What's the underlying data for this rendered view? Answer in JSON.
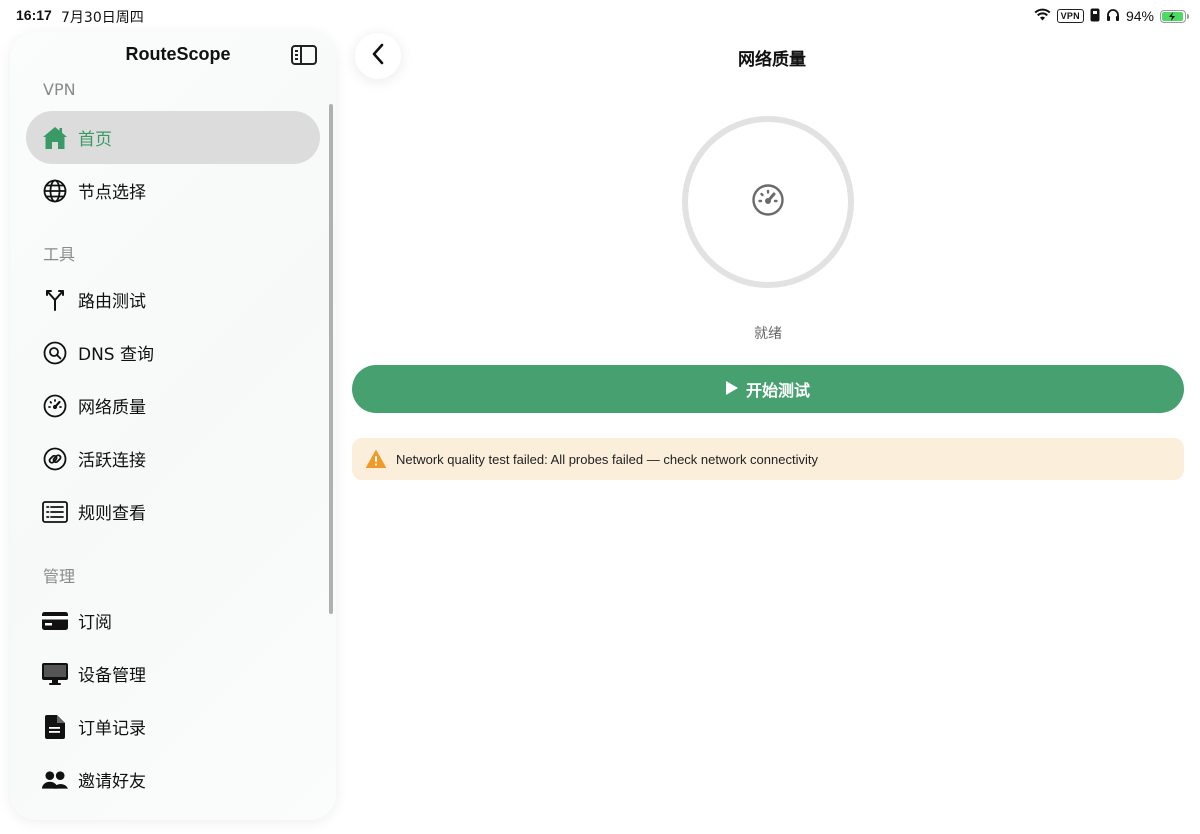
{
  "status_bar": {
    "time": "16:17",
    "date": "7月30日周四",
    "vpn_badge": "VPN",
    "battery": "94%",
    "battery_level_percent": 94,
    "icons": [
      "wifi-icon",
      "vpn-icon",
      "lock-icon",
      "headphones-icon",
      "battery-charging-icon"
    ]
  },
  "sidebar": {
    "title": "RouteScope",
    "sections": [
      {
        "label": "VPN"
      },
      {
        "label": "工具"
      },
      {
        "label": "管理"
      }
    ],
    "items": [
      {
        "label": "首页",
        "icon": "home-icon",
        "active": true
      },
      {
        "label": "节点选择",
        "icon": "globe-icon"
      },
      {
        "label": "路由测试",
        "icon": "route-split-icon"
      },
      {
        "label": "DNS 查询",
        "icon": "search-icon"
      },
      {
        "label": "网络质量",
        "icon": "speedometer-icon"
      },
      {
        "label": "活跃连接",
        "icon": "link-icon"
      },
      {
        "label": "规则查看",
        "icon": "list-icon"
      },
      {
        "label": "订阅",
        "icon": "card-icon"
      },
      {
        "label": "设备管理",
        "icon": "monitor-icon"
      },
      {
        "label": "订单记录",
        "icon": "document-icon"
      },
      {
        "label": "邀请好友",
        "icon": "people-icon"
      }
    ]
  },
  "main": {
    "title": "网络质量",
    "status": "就绪",
    "start_button": "开始测试",
    "error_message": "Network quality test failed: All probes failed — check network connectivity"
  },
  "colors": {
    "accent": "#47a070",
    "active_text": "#3a9a66",
    "warning_bg": "#fbeedb",
    "warning_icon": "#f09a28"
  }
}
